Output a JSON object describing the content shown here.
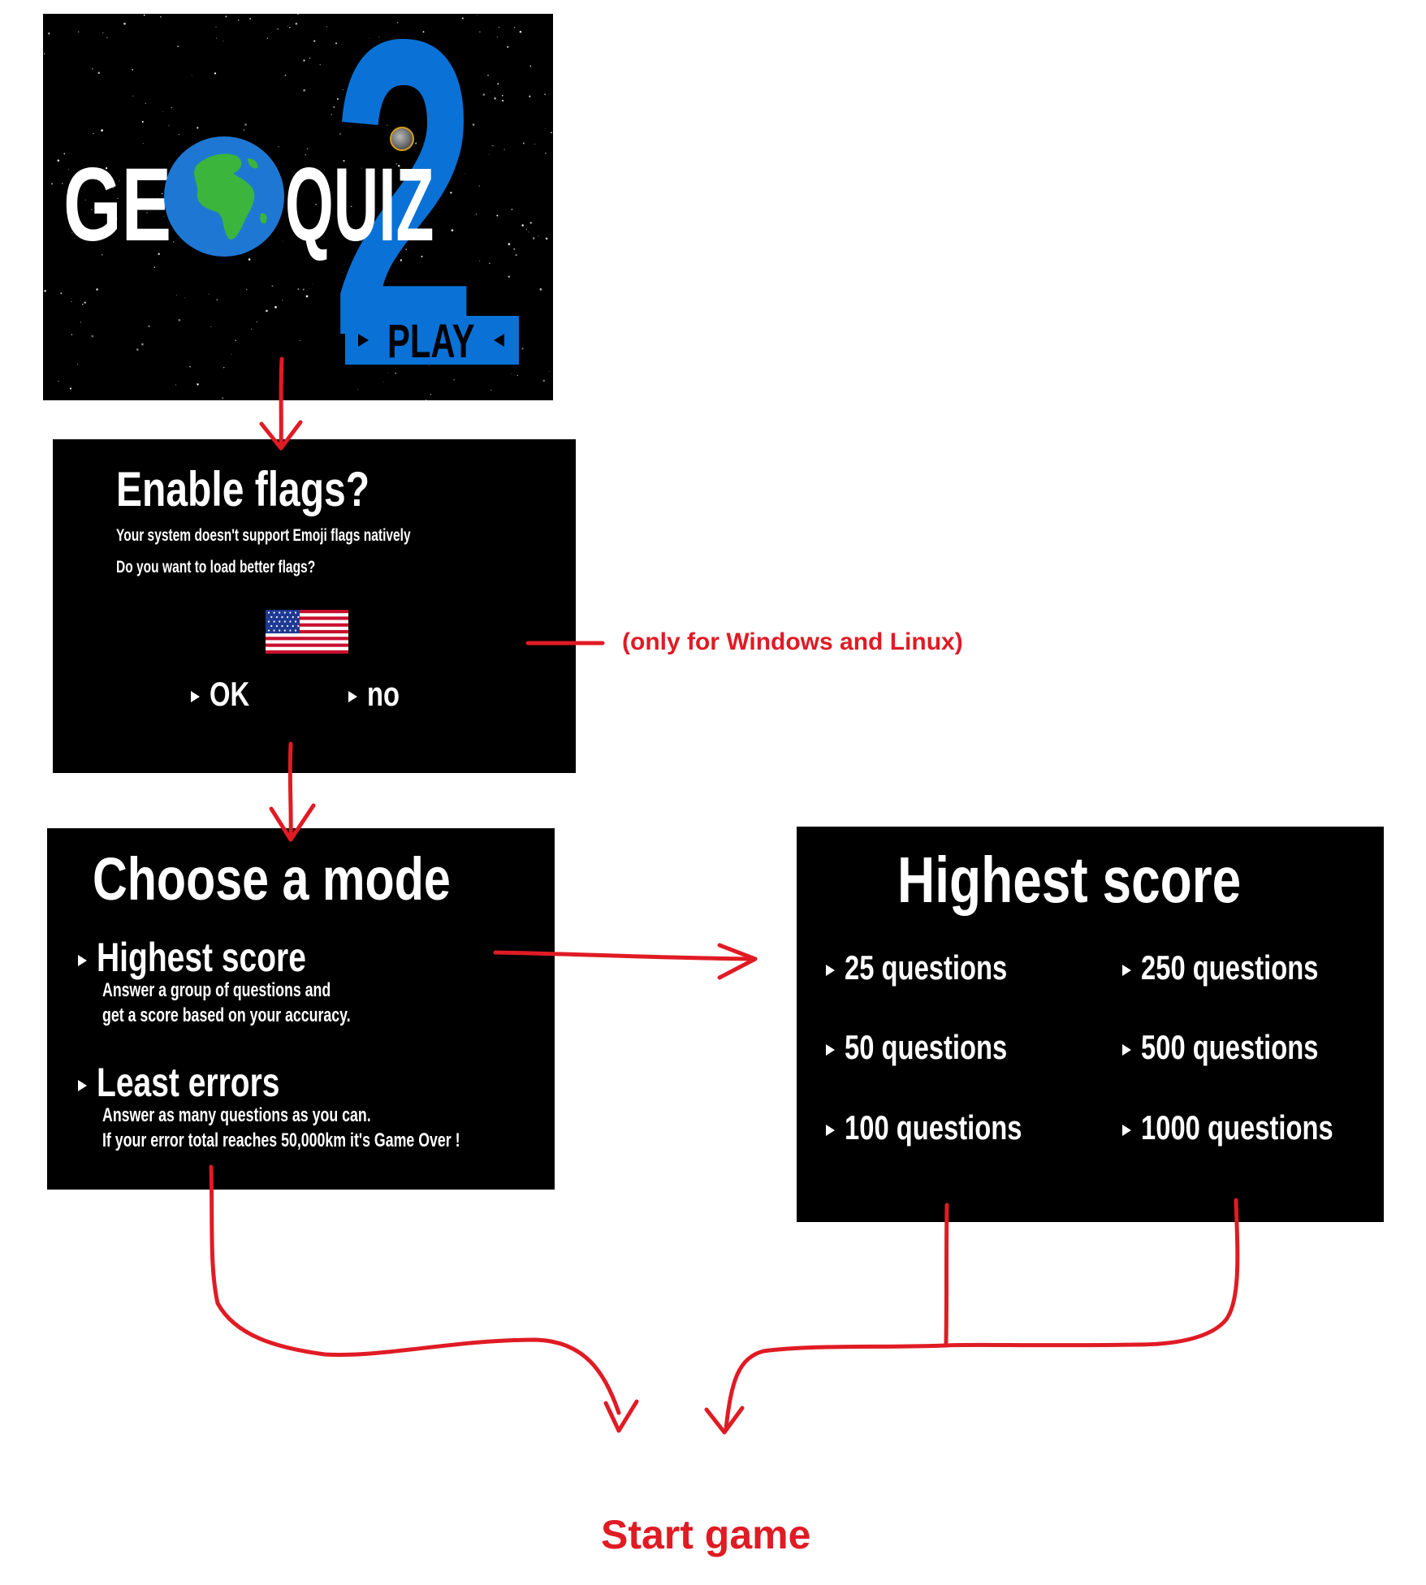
{
  "title_screen": {
    "word_left": "GE",
    "word_right": "QUIZ",
    "number": "2",
    "play_label": "PLAY"
  },
  "flags_screen": {
    "title": "Enable flags?",
    "line1": "Your system doesn't support Emoji flags natively",
    "line2": "Do you want to load better flags?",
    "ok_label": "OK",
    "no_label": "no"
  },
  "platform_note": "(only for Windows and Linux)",
  "mode_screen": {
    "title": "Choose a mode",
    "modes": [
      {
        "label": "Highest score",
        "desc1": "Answer a group of questions and",
        "desc2": "get a score based on your accuracy."
      },
      {
        "label": "Least errors",
        "desc1": "Answer as many questions as you can.",
        "desc2": "If your error total reaches 50,000km it's Game Over !"
      }
    ]
  },
  "score_screen": {
    "title": "Highest score",
    "options": [
      "25 questions",
      "50 questions",
      "100 questions",
      "250 questions",
      "500 questions",
      "1000 questions"
    ]
  },
  "start_label": "Start game",
  "colors": {
    "annotation_red": "#e01b24",
    "logo_blue": "#0a72d6",
    "panel_black": "#000000"
  }
}
